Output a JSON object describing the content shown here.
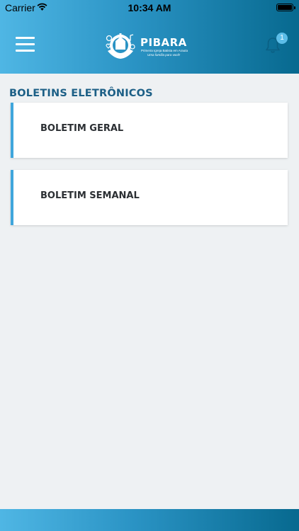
{
  "status_bar": {
    "carrier": "Carrier",
    "time": "10:34 AM",
    "wifi_icon": "wifi-icon",
    "battery_icon": "battery-icon"
  },
  "header": {
    "menu_icon": "hamburger-menu-icon",
    "logo": {
      "name": "PIBARA",
      "subtitle": "Primeira Igreja Batista em Arauta",
      "tagline": "Uma família para você!"
    },
    "notifications": {
      "icon": "bell-icon",
      "count": "1"
    },
    "gradient_start": "#4fb6e4",
    "gradient_end": "#07698f"
  },
  "main": {
    "section_title": "BOLETINS ELETRÔNICOS",
    "cards": [
      {
        "label": "BOLETIM GERAL"
      },
      {
        "label": "BOLETIM SEMANAL"
      }
    ],
    "accent_color": "#3fa6dc"
  }
}
